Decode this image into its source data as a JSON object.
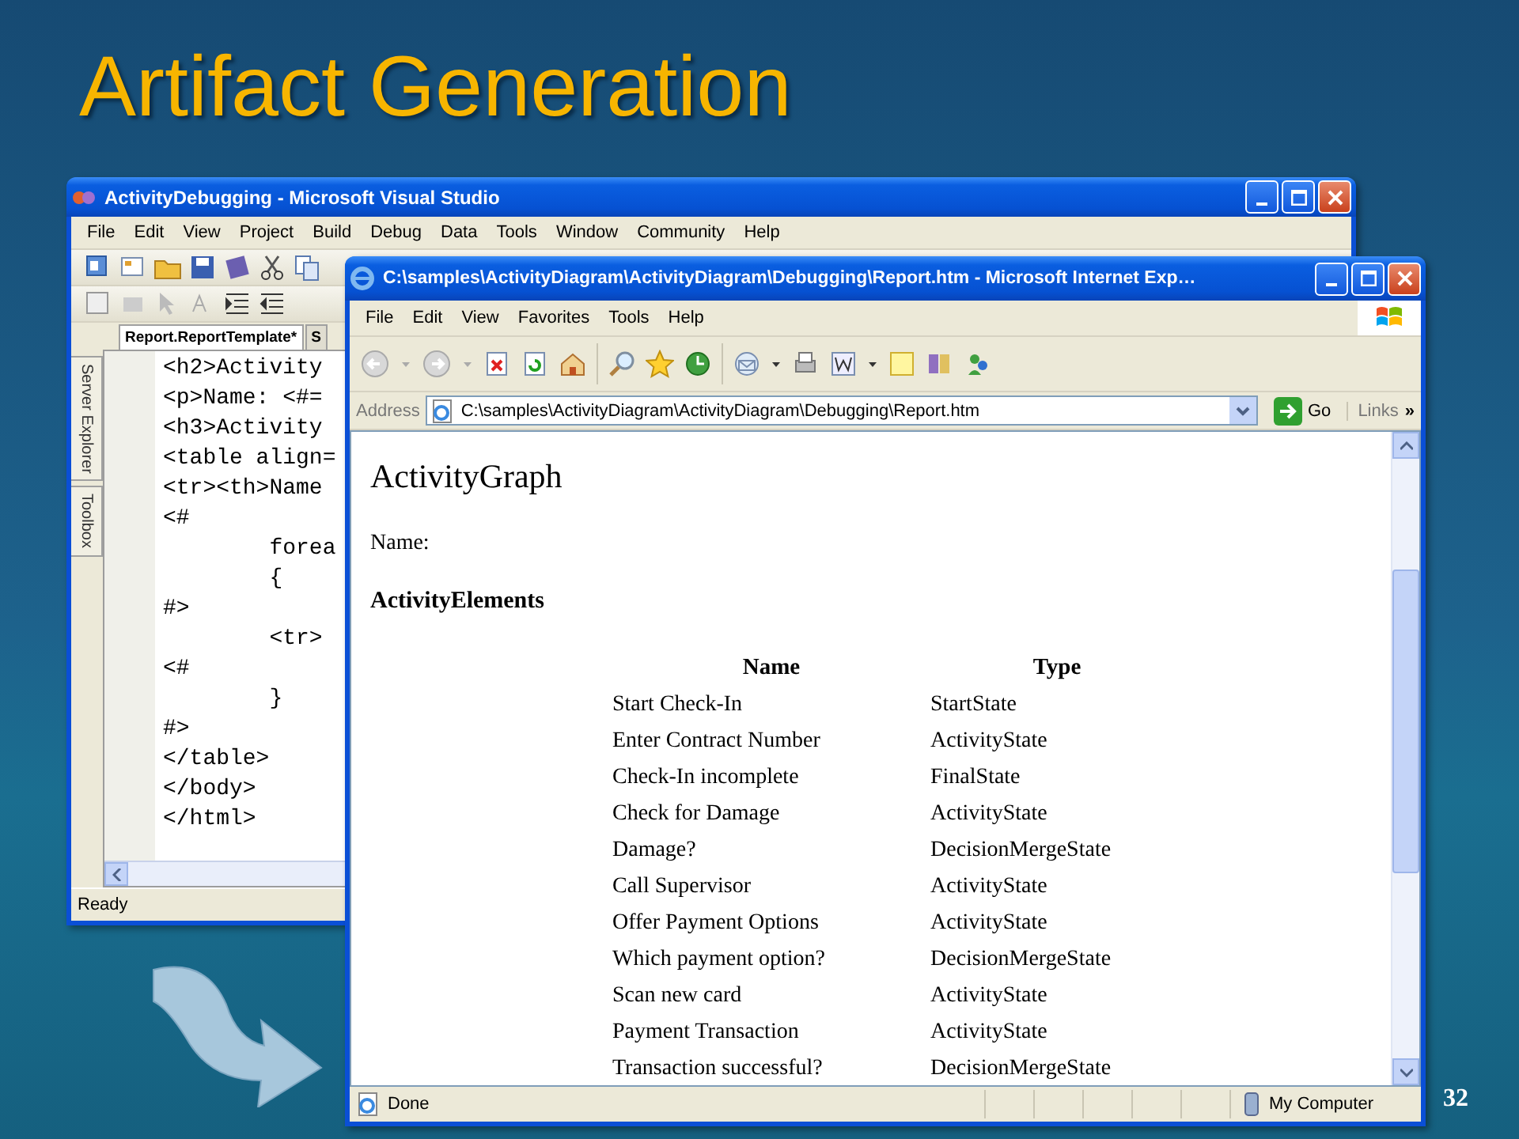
{
  "slide": {
    "title": "Artifact Generation",
    "page_number": "32"
  },
  "vs_window": {
    "title": "ActivityDebugging - Microsoft Visual Studio",
    "menu": [
      "File",
      "Edit",
      "View",
      "Project",
      "Build",
      "Debug",
      "Data",
      "Tools",
      "Window",
      "Community",
      "Help"
    ],
    "tabs": [
      {
        "label": "Report.ReportTemplate*",
        "selected": true
      },
      {
        "label": "S",
        "selected": false
      }
    ],
    "side_tabs": [
      "Server Explorer",
      "Toolbox"
    ],
    "code_lines": [
      {
        "text": "<h2>Activity"
      },
      {
        "text": "<p>Name: <#="
      },
      {
        "text": "<h3>Activity"
      },
      {
        "text": "<table align="
      },
      {
        "text": "<tr><th>Name"
      },
      {
        "text": "<#"
      },
      {
        "text": "        forea"
      },
      {
        "text": "        {"
      },
      {
        "text": "#>"
      },
      {
        "text": "        <tr>"
      },
      {
        "text": "<#"
      },
      {
        "text": "        }"
      },
      {
        "text": "#>"
      },
      {
        "text": "</table>"
      },
      {
        "text": "</body>"
      },
      {
        "text": "</html>"
      }
    ],
    "status": "Ready"
  },
  "ie_window": {
    "title": "C:\\samples\\ActivityDiagram\\ActivityDiagram\\Debugging\\Report.htm - Microsoft Internet Exp…",
    "menu": [
      "File",
      "Edit",
      "View",
      "Favorites",
      "Tools",
      "Help"
    ],
    "address_label": "Address",
    "address": "C:\\samples\\ActivityDiagram\\ActivityDiagram\\Debugging\\Report.htm",
    "go_button": "Go",
    "links": "Links",
    "links_more": "»",
    "page": {
      "heading": "ActivityGraph",
      "name_label": "Name:",
      "subheading": "ActivityElements",
      "columns": [
        "Name",
        "Type"
      ],
      "rows": [
        [
          "Start Check-In",
          "StartState"
        ],
        [
          "Enter Contract Number",
          "ActivityState"
        ],
        [
          "Check-In incomplete",
          "FinalState"
        ],
        [
          "Check for Damage",
          "ActivityState"
        ],
        [
          "Damage?",
          "DecisionMergeState"
        ],
        [
          "Call Supervisor",
          "ActivityState"
        ],
        [
          "Offer Payment Options",
          "ActivityState"
        ],
        [
          "Which payment option?",
          "DecisionMergeState"
        ],
        [
          "Scan new card",
          "ActivityState"
        ],
        [
          "Payment Transaction",
          "ActivityState"
        ],
        [
          "Transaction successful?",
          "DecisionMergeState"
        ]
      ]
    },
    "status": "Done",
    "zone": "My Computer"
  }
}
